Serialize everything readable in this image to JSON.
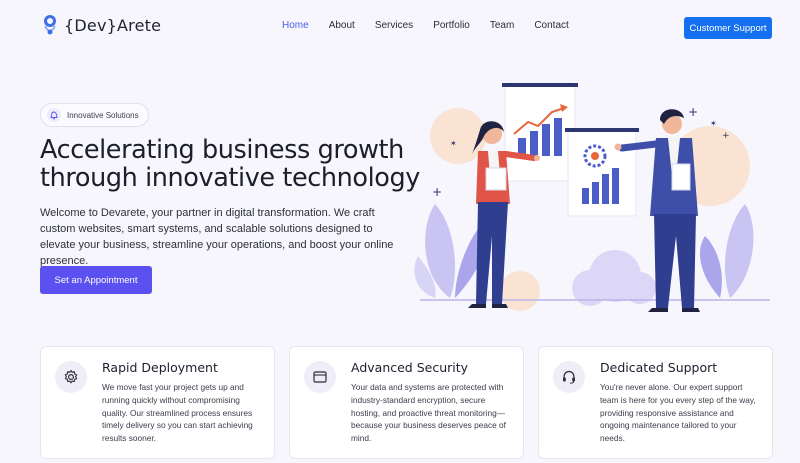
{
  "brand": {
    "logo_text": "{Dev}Arete"
  },
  "nav": {
    "items": [
      {
        "label": "Home",
        "active": true
      },
      {
        "label": "About",
        "active": false
      },
      {
        "label": "Services",
        "active": false
      },
      {
        "label": "Portfolio",
        "active": false
      },
      {
        "label": "Team",
        "active": false
      },
      {
        "label": "Contact",
        "active": false
      }
    ],
    "support_button": "Customer Support"
  },
  "hero": {
    "badge": "Innovative Solutions",
    "title": "Accelerating business growth through innovative technology",
    "description": "Welcome to Devarete, your partner in digital transformation. We craft custom websites, smart systems, and scalable solutions designed to elevate your business, streamline your operations, and boost your online presence.",
    "cta": "Set an Appointment"
  },
  "features": [
    {
      "icon": "gear-icon",
      "title": "Rapid Deployment",
      "text": "We move fast your project gets up and running quickly without compromising quality. Our streamlined process ensures timely delivery so you can start achieving results sooner."
    },
    {
      "icon": "browser-window-icon",
      "title": "Advanced Security",
      "text": "Your data and systems are protected with industry-standard encryption, secure hosting, and proactive threat monitoring—because your business deserves peace of mind."
    },
    {
      "icon": "headset-icon",
      "title": "Dedicated Support",
      "text": "You're never alone. Our expert support team is here for you every step of the way, providing responsive assistance and ongoing maintenance tailored to your needs."
    }
  ],
  "colors": {
    "primary": "#1570ef",
    "accent": "#5b50f0",
    "nav_active": "#4a5fe8",
    "background": "#f7f6fd"
  }
}
